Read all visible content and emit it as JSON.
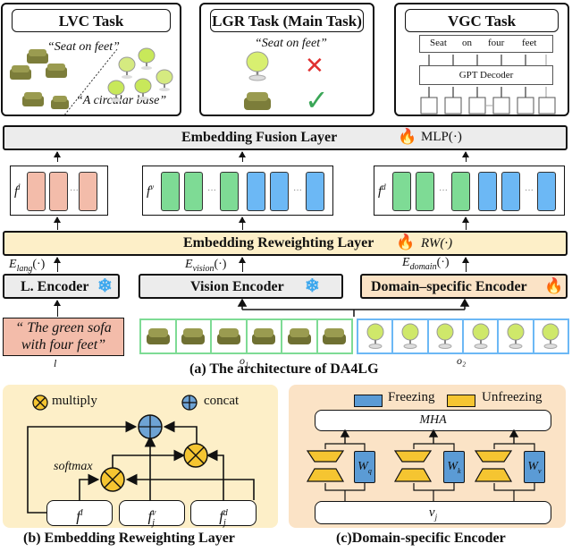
{
  "tasks": {
    "lvc": {
      "title": "LVC Task",
      "quote1": "“Seat on feet”",
      "quote2": "“A circular base”"
    },
    "lgr": {
      "title": "LGR Task (Main Task)",
      "quote": "“Seat on feet”",
      "wrong_mark": "✕",
      "right_mark": "✓"
    },
    "vgc": {
      "title": "VGC Task",
      "tokens": [
        "Seat",
        "on",
        "four",
        "feet"
      ],
      "decoder": "GPT Decoder"
    }
  },
  "architecture": {
    "fusion_layer": {
      "label": "Embedding Fusion Layer",
      "fn": "MLP(·)",
      "icon": "fire-icon"
    },
    "features": {
      "lang": {
        "label": "f",
        "sup": "l"
      },
      "vision": {
        "label": "f",
        "sup": "v"
      },
      "domain": {
        "label": "f",
        "sup": "d"
      },
      "ellipsis": "···"
    },
    "reweighting_layer": {
      "label": "Embedding Reweighting Layer",
      "fn": "RW(·)",
      "icon": "fire-icon"
    },
    "encoder_outputs": {
      "lang": {
        "base": "E",
        "sub": "lang",
        "tail": "(·)"
      },
      "vision": {
        "base": "E",
        "sub": "vision",
        "tail": "(·)"
      },
      "domain": {
        "base": "E",
        "sub": "domain",
        "tail": "(·)"
      }
    },
    "encoders": {
      "lang": {
        "label": "L. Encoder",
        "state": "frozen"
      },
      "vision": {
        "label": "Vision Encoder",
        "state": "frozen"
      },
      "domain": {
        "label": "Domain–specific Encoder",
        "state": "trainable"
      }
    },
    "inputs": {
      "text": "“ The green sofa with four feet”",
      "text_symbol": "l",
      "object1_symbol": "o₁",
      "object2_symbol": "o₂",
      "object1_views": 6,
      "object2_views": 6
    },
    "caption": "(a) The architecture of DA4LG"
  },
  "reweighting_panel": {
    "legend": {
      "multiply": "multiply",
      "concat": "concat"
    },
    "softmax_label": "softmax",
    "nodes": [
      {
        "base": "f",
        "sup": "l",
        "sub": ""
      },
      {
        "base": "f",
        "sup": "v",
        "sub": "j"
      },
      {
        "base": "f",
        "sup": "d",
        "sub": "j"
      }
    ],
    "caption": "(b) Embedding Reweighting Layer"
  },
  "domain_panel": {
    "legend": {
      "freezing": "Freezing",
      "unfreezing": "Unfreezing"
    },
    "mha_label": "MHA",
    "weights": [
      {
        "base": "W",
        "sub": "q"
      },
      {
        "base": "W",
        "sub": "k"
      },
      {
        "base": "W",
        "sub": "v"
      }
    ],
    "input": {
      "base": "v",
      "sub": "j"
    },
    "caption": "(c)Domain-specific Encoder"
  },
  "colors": {
    "pink": "#f3bcaa",
    "green": "#7edb95",
    "blue": "#6cb8f5",
    "reweight_bg": "#fdefc8",
    "domain_bg": "#fbe3c6",
    "fusion_bg": "#ececec",
    "yellow": "#f5c531",
    "concat_blue": "#6ea3d4",
    "weight_blue": "#5b9bd5"
  }
}
